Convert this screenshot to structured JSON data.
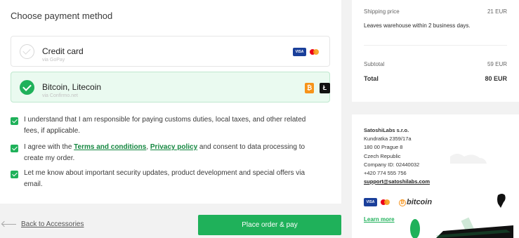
{
  "payment": {
    "title": "Choose payment method",
    "options": [
      {
        "label": "Credit card",
        "sub": "via GoPay",
        "selected": false,
        "icons": [
          "visa-icon",
          "mastercard-icon"
        ]
      },
      {
        "label": "Bitcoin, Litecoin",
        "sub": "via Confirmo.net",
        "selected": true,
        "icons": [
          "bitcoin-icon",
          "litecoin-icon"
        ]
      }
    ],
    "visa_text": "VISA"
  },
  "consents": {
    "customs": "I understand that I am responsible for paying customs duties, local taxes, and other related fees, if applicable.",
    "terms_prefix": "I agree with the ",
    "terms_link": "Terms and conditions",
    "terms_comma": ", ",
    "privacy_link": "Privacy policy",
    "terms_suffix": " and consent to data processing to create my order.",
    "updates": "Let me know about important security updates, product development and special offers via email."
  },
  "actions": {
    "back": "Back to Accessories",
    "place_order": "Place order & pay"
  },
  "summary": {
    "shipping_label": "Shipping price",
    "shipping_value": "21 EUR",
    "leaves_note": "Leaves warehouse within 2 business days.",
    "subtotal_label": "Subtotal",
    "subtotal_value": "59 EUR",
    "total_label": "Total",
    "total_value": "80 EUR"
  },
  "company": {
    "name": "SatoshiLabs s.r.o.",
    "street": "Kundratka 2359/17a",
    "city": "180 00 Prague 8",
    "country": "Czech Republic",
    "company_id": "Company ID: 02440032",
    "phone": "+420 774 555 756",
    "email": "support@satoshilabs.com",
    "bitcoin": "bitcoin",
    "learn_more": "Learn more"
  },
  "colors": {
    "accent": "#1fb15a",
    "link": "#13863f",
    "selected_bg": "#eafaf0"
  }
}
